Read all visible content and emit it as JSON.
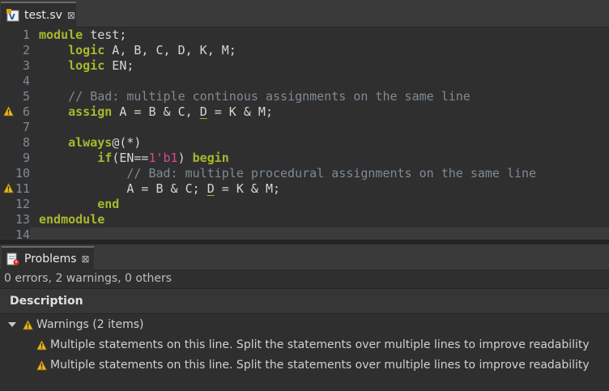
{
  "editor": {
    "tab_label": "test.sv",
    "tab_close": "⊠",
    "lines": [
      {
        "n": "1"
      },
      {
        "n": "2"
      },
      {
        "n": "3"
      },
      {
        "n": "4"
      },
      {
        "n": "5"
      },
      {
        "n": "6"
      },
      {
        "n": "7"
      },
      {
        "n": "8"
      },
      {
        "n": "9"
      },
      {
        "n": "10"
      },
      {
        "n": "11"
      },
      {
        "n": "12"
      },
      {
        "n": "13"
      },
      {
        "n": "14"
      }
    ],
    "tokens": {
      "l1_kw": "module",
      "l1_rest": " test;",
      "l2_kw": "logic",
      "l2_rest": " A, B, C, D, K, M;",
      "l3_kw": "logic",
      "l3_rest": " EN;",
      "l5_cm": "// Bad: multiple continous assignments on the same line",
      "l6_kw": "assign",
      "l6_a": " A = B & C, ",
      "l6_u": "D",
      "l6_b": " = K & M;",
      "l8_kw": "always",
      "l8_rest": "@(*)",
      "l9_kw": "if",
      "l9_a": "(EN==",
      "l9_num": "1'b1",
      "l9_b": ") ",
      "l9_kw2": "begin",
      "l10_cm": "// Bad: multiple procedural assignments on the same line",
      "l11_a": "A = B & C; ",
      "l11_u": "D",
      "l11_b": " = K & M;",
      "l12_kw": "end",
      "l13_kw": "endmodule"
    }
  },
  "problems": {
    "tab_label": "Problems",
    "tab_close": "⊠",
    "summary": "0 errors, 2 warnings, 0 others",
    "column_description": "Description",
    "group_label": "Warnings (2 items)",
    "items": [
      "Multiple statements on this line. Split the statements over multiple lines to improve readability",
      "Multiple statements on this line. Split the statements over multiple lines to improve readability"
    ]
  },
  "colors": {
    "keyword": "#a8b82d",
    "comment": "#7f8a96",
    "number": "#d94a8c",
    "warning": "#e8b62c",
    "background": "#2f2f2f"
  },
  "icons": {
    "file": "systemverilog-file-icon",
    "problems": "problems-view-icon",
    "warning": "warning-icon",
    "twisty": "chevron-down-icon"
  }
}
